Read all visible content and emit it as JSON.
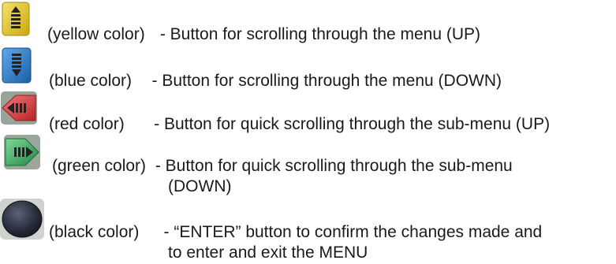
{
  "legend": {
    "items": [
      {
        "icon": "yellow-scroll-up-button-icon",
        "color_hex": "#e2c21c",
        "color_label": "(yellow color)",
        "desc": " - Button for scrolling through the menu (UP)",
        "desc_cont": ""
      },
      {
        "icon": "blue-scroll-down-button-icon",
        "color_hex": "#2b7fd0",
        "color_label": "(blue color)",
        "desc": "   - Button for scrolling through the menu (DOWN)",
        "desc_cont": ""
      },
      {
        "icon": "red-quick-scroll-up-button-icon",
        "color_hex": "#d63c3c",
        "color_label": "(red color)",
        "desc": "     - Button for quick scrolling through the sub-menu (UP)",
        "desc_cont": ""
      },
      {
        "icon": "green-quick-scroll-down-button-icon",
        "color_hex": "#3aa85a",
        "color_label": "(green color)",
        "desc": " - Button for quick scrolling through the sub-menu",
        "desc_cont": "(DOWN)"
      },
      {
        "icon": "black-enter-button-icon",
        "color_hex": "#2d3340",
        "color_label": "(black color)",
        "desc": "   - “ENTER” button to confirm the changes made and",
        "desc_cont": "to enter and exit the MENU"
      }
    ]
  }
}
